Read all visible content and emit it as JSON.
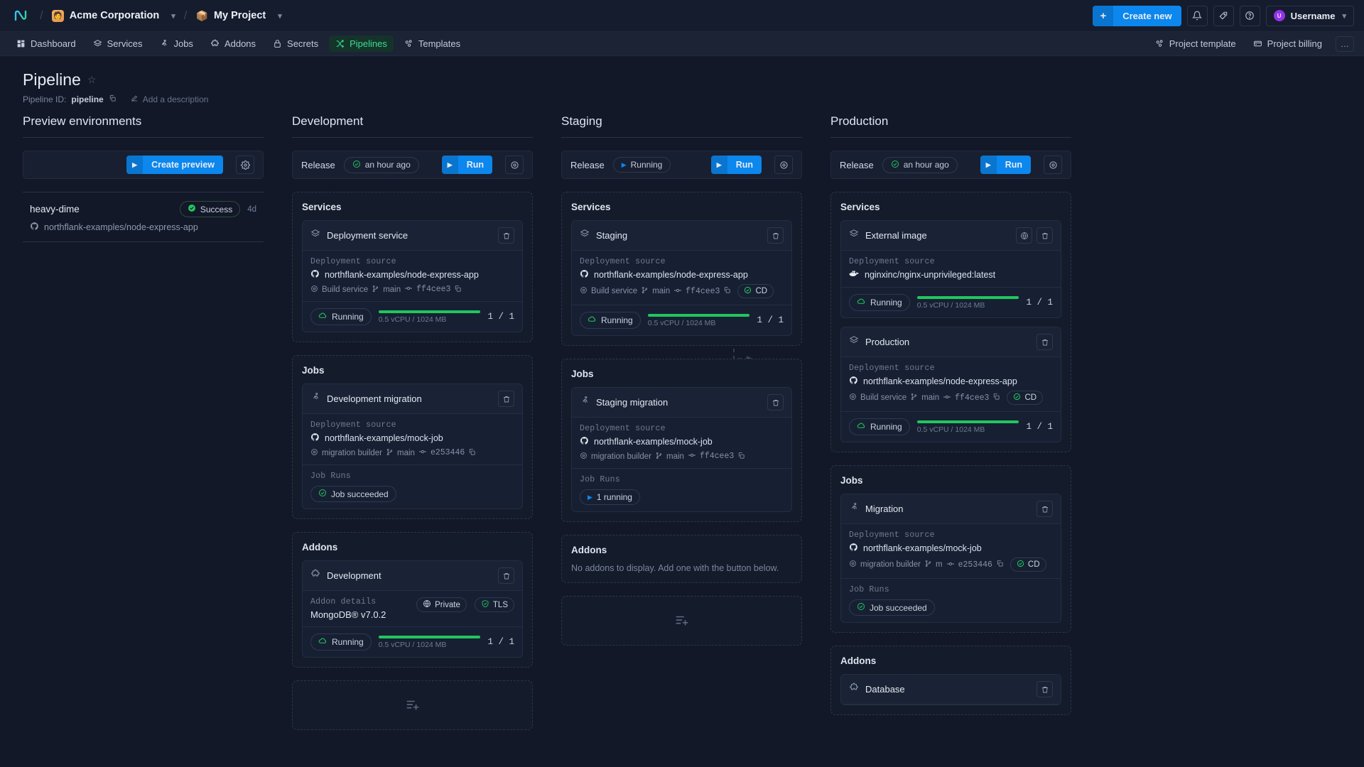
{
  "topbar": {
    "logo_icon": "northflank-logo",
    "org": {
      "name": "Acme Corporation",
      "avatar_icon": "org-avatar",
      "chevron": "chevron-down-icon"
    },
    "project": {
      "name": "My Project",
      "icon": "package-icon",
      "chevron": "chevron-down-icon"
    },
    "create_new": {
      "label": "Create new",
      "plus": "+"
    },
    "icons": [
      "bell-icon",
      "rocket-icon",
      "help-icon"
    ],
    "user": {
      "name": "Username",
      "initial": "U"
    }
  },
  "nav": {
    "left": [
      {
        "label": "Dashboard",
        "icon": "grid-icon",
        "active": false
      },
      {
        "label": "Services",
        "icon": "layers-icon",
        "active": false
      },
      {
        "label": "Jobs",
        "icon": "runner-icon",
        "active": false
      },
      {
        "label": "Addons",
        "icon": "puzzle-icon",
        "active": false
      },
      {
        "label": "Secrets",
        "icon": "lock-icon",
        "active": false
      },
      {
        "label": "Pipelines",
        "icon": "shuffle-icon",
        "active": true
      },
      {
        "label": "Templates",
        "icon": "template-icon",
        "active": false
      }
    ],
    "right": [
      {
        "label": "Project template",
        "icon": "template-icon"
      },
      {
        "label": "Project billing",
        "icon": "card-icon"
      }
    ],
    "more": "…"
  },
  "page": {
    "title": "Pipeline",
    "star_icon": "star-icon",
    "id_label": "Pipeline ID:",
    "id_value": "pipeline",
    "copy_icon": "copy-icon",
    "add_description": "Add a description",
    "edit_icon": "edit-icon"
  },
  "colors": {
    "accent_blue": "#0b87ee",
    "success_green": "#22c55e",
    "active_tab": "#3ddc97",
    "bg": "#121828",
    "panel": "#172033"
  },
  "columns": [
    {
      "title": "Preview environments",
      "type": "preview",
      "action": {
        "label": "Create preview",
        "play_icon": "play-icon",
        "gear_icon": "gear-icon"
      },
      "items": [
        {
          "name": "heavy-dime",
          "status": "Success",
          "status_icon": "check-circle-icon",
          "age": "4d",
          "repo": "northflank-examples/node-express-app",
          "repo_icon": "github-icon"
        }
      ]
    },
    {
      "title": "Development",
      "type": "stage",
      "release": {
        "label": "Release",
        "status": "an hour ago",
        "status_icon": "check-circle-icon",
        "run_label": "Run",
        "play_icon": "play-icon",
        "gear_icon": "gear-icon"
      },
      "groups": [
        {
          "title": "Services",
          "cards": [
            {
              "name": "Deployment service",
              "icon": "layers-icon",
              "actions": [
                "trash-icon"
              ],
              "source_label": "Deployment source",
              "source": "northflank-examples/node-express-app",
              "source_icon": "github-icon",
              "meta": {
                "builder": "Build service",
                "branch": "main",
                "commit": "ff4cee3",
                "copy_icon": "copy-icon",
                "cd": null
              },
              "status": "Running",
              "status_icon": "cloud-icon",
              "resources": "0.5 vCPU / 1024 MB",
              "ratio": "1 / 1",
              "bar_pct": 100
            }
          ]
        },
        {
          "title": "Jobs",
          "cards": [
            {
              "name": "Development migration",
              "icon": "runner-icon",
              "actions": [
                "trash-icon"
              ],
              "source_label": "Deployment source",
              "source": "northflank-examples/mock-job",
              "source_icon": "github-icon",
              "meta": {
                "builder": "migration builder",
                "branch": "main",
                "commit": "e253446",
                "copy_icon": "copy-icon",
                "cd": null
              },
              "runs_label": "Job Runs",
              "run_status": "Job succeeded",
              "run_icon": "check-circle-icon"
            }
          ]
        },
        {
          "title": "Addons",
          "cards": [
            {
              "name": "Development",
              "icon": "puzzle-icon",
              "actions": [
                "trash-icon"
              ],
              "details_label": "Addon details",
              "details_value": "MongoDB® v7.0.2",
              "tags": [
                {
                  "label": "Private",
                  "icon": "globe-icon"
                },
                {
                  "label": "TLS",
                  "icon": "shield-check-icon"
                }
              ],
              "status": "Running",
              "status_icon": "cloud-icon",
              "resources": "0.5 vCPU / 1024 MB",
              "ratio": "1 / 1",
              "bar_pct": 100
            }
          ]
        }
      ],
      "add_box_icon": "add-stack-icon"
    },
    {
      "title": "Staging",
      "type": "stage",
      "release": {
        "label": "Release",
        "status": "Running",
        "status_icon": "play-icon",
        "run_label": "Run",
        "play_icon": "play-icon",
        "gear_icon": "gear-icon"
      },
      "groups": [
        {
          "title": "Services",
          "cards": [
            {
              "name": "Staging",
              "icon": "layers-icon",
              "actions": [
                "trash-icon"
              ],
              "source_label": "Deployment source",
              "source": "northflank-examples/node-express-app",
              "source_icon": "github-icon",
              "meta": {
                "builder": "Build service",
                "branch": "main",
                "commit": "ff4cee3",
                "copy_icon": "copy-icon",
                "cd": "CD"
              },
              "status": "Running",
              "status_icon": "cloud-icon",
              "resources": "0.5 vCPU / 1024 MB",
              "ratio": "1 / 1",
              "bar_pct": 100
            }
          ]
        },
        {
          "title": "Jobs",
          "cards": [
            {
              "name": "Staging migration",
              "icon": "runner-icon",
              "actions": [
                "trash-icon"
              ],
              "source_label": "Deployment source",
              "source": "northflank-examples/mock-job",
              "source_icon": "github-icon",
              "meta": {
                "builder": "migration builder",
                "branch": "main",
                "commit": "ff4cee3",
                "copy_icon": "copy-icon",
                "cd": null
              },
              "runs_label": "Job Runs",
              "run_status": "1 running",
              "run_icon": "play-icon"
            }
          ]
        },
        {
          "title": "Addons",
          "empty_text": "No addons to display. Add one with the button below.",
          "cards": []
        }
      ],
      "add_box_icon": "add-stack-icon"
    },
    {
      "title": "Production",
      "type": "stage",
      "release": {
        "label": "Release",
        "status": "an hour ago",
        "status_icon": "check-circle-icon",
        "run_label": "Run",
        "play_icon": "play-icon",
        "gear_icon": "gear-icon"
      },
      "groups": [
        {
          "title": "Services",
          "cards": [
            {
              "name": "External image",
              "icon": "layers-icon",
              "actions": [
                "globe-icon",
                "trash-icon"
              ],
              "source_label": "Deployment source",
              "source": "nginxinc/nginx-unprivileged:latest",
              "source_icon": "docker-icon",
              "meta": null,
              "status": "Running",
              "status_icon": "cloud-icon",
              "resources": "0.5 vCPU / 1024 MB",
              "ratio": "1 / 1",
              "bar_pct": 100
            },
            {
              "name": "Production",
              "icon": "layers-icon",
              "actions": [
                "trash-icon"
              ],
              "source_label": "Deployment source",
              "source": "northflank-examples/node-express-app",
              "source_icon": "github-icon",
              "meta": {
                "builder": "Build service",
                "branch": "main",
                "commit": "ff4cee3",
                "copy_icon": "copy-icon",
                "cd": "CD"
              },
              "status": "Running",
              "status_icon": "cloud-icon",
              "resources": "0.5 vCPU / 1024 MB",
              "ratio": "1 / 1",
              "bar_pct": 100
            }
          ]
        },
        {
          "title": "Jobs",
          "cards": [
            {
              "name": "Migration",
              "icon": "runner-icon",
              "actions": [
                "trash-icon"
              ],
              "source_label": "Deployment source",
              "source": "northflank-examples/mock-job",
              "source_icon": "github-icon",
              "meta": {
                "builder": "migration builder",
                "branch": "m",
                "commit": "e253446",
                "copy_icon": "copy-icon",
                "cd": "CD"
              },
              "runs_label": "Job Runs",
              "run_status": "Job succeeded",
              "run_icon": "check-circle-icon"
            }
          ]
        },
        {
          "title": "Addons",
          "cards": [
            {
              "name": "Database",
              "icon": "puzzle-icon",
              "actions": [
                "trash-icon"
              ]
            }
          ]
        }
      ]
    }
  ]
}
